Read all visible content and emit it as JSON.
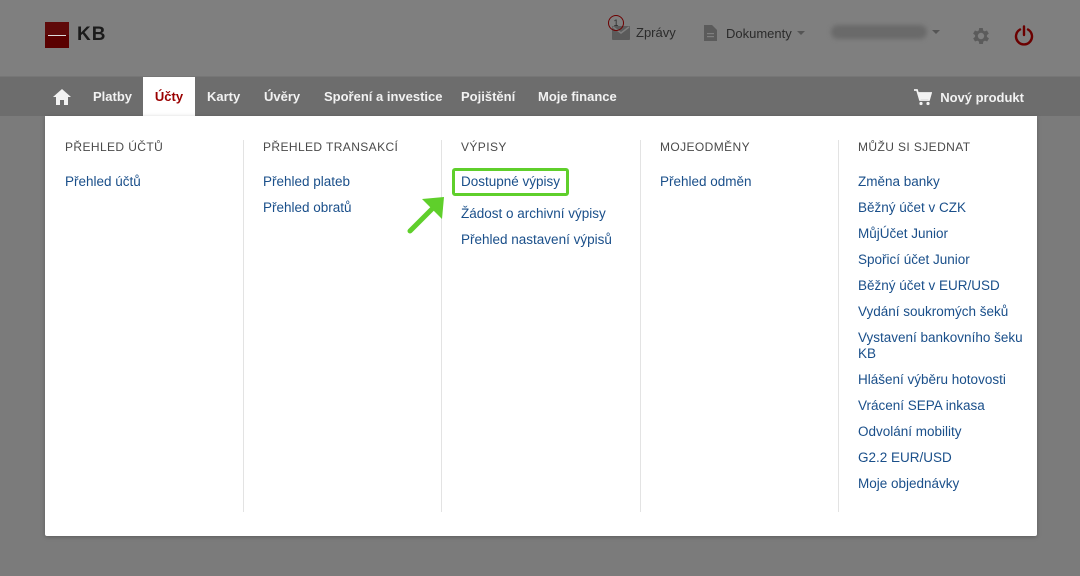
{
  "header": {
    "logo_text": "KB",
    "messages_count": "1",
    "messages_label": "Zprávy",
    "documents_label": "Dokumenty",
    "settings_icon": "gear-icon",
    "logout_icon": "power-icon"
  },
  "nav": {
    "home_icon": "home-icon",
    "items": [
      "Platby",
      "Účty",
      "Karty",
      "Úvěry",
      "Spoření a investice",
      "Pojištění",
      "Moje finance"
    ],
    "active_item": "Účty",
    "new_product_label": "Nový produkt"
  },
  "menu": {
    "columns": [
      {
        "title": "PŘEHLED ÚČTŮ",
        "links": [
          "Přehled účtů"
        ]
      },
      {
        "title": "PŘEHLED TRANSAKCÍ",
        "links": [
          "Přehled plateb",
          "Přehled obratů"
        ]
      },
      {
        "title": "VÝPISY",
        "links": [
          "Dostupné výpisy",
          "Žádost o archivní výpisy",
          "Přehled nastavení výpisů"
        ]
      },
      {
        "title": "MOJEODMĚNY",
        "links": [
          "Přehled odměn"
        ]
      },
      {
        "title": "MŮŽU SI SJEDNAT",
        "links": [
          "Změna banky",
          "Běžný účet v CZK",
          "MůjÚčet Junior",
          "Spořicí účet Junior",
          "Běžný účet v EUR/USD",
          "Vydání soukromých šeků",
          "Vystavení bankovního šeku KB",
          "Hlášení výběru hotovosti",
          "Vrácení SEPA inkasa",
          "Odvolání mobility",
          "G2.2 EUR/USD",
          "Moje objednávky"
        ]
      }
    ],
    "highlighted_link": "Dostupné výpisy",
    "highlight_color": "#5fcf2b"
  },
  "colors": {
    "brand_red": "#9a0000",
    "link_blue": "#1a4f8a"
  }
}
